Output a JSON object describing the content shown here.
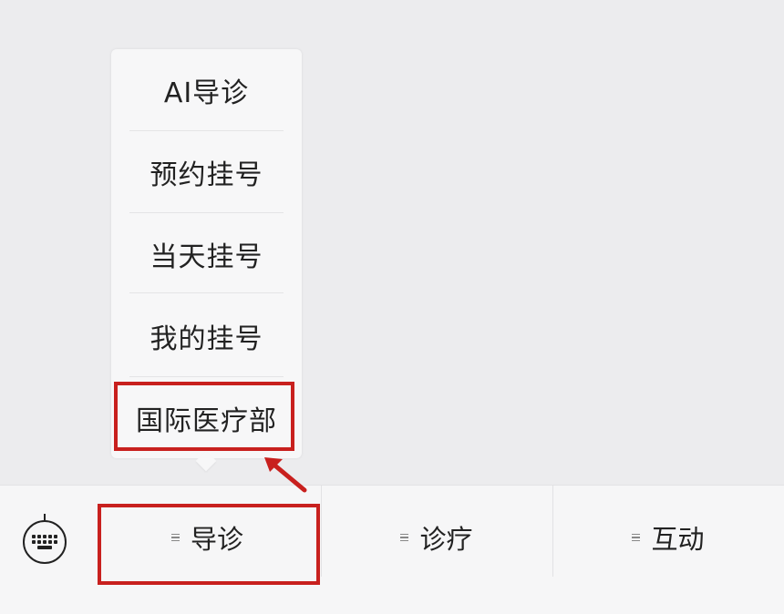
{
  "menu": {
    "items": [
      {
        "label": "AI导诊"
      },
      {
        "label": "预约挂号"
      },
      {
        "label": "当天挂号"
      },
      {
        "label": "我的挂号"
      },
      {
        "label": "国际医疗部"
      }
    ]
  },
  "bottom_bar": {
    "keyboard_icon": "keyboard-icon",
    "tabs": [
      {
        "label": "导诊",
        "icon": "menu-lines-icon"
      },
      {
        "label": "诊疗",
        "icon": "menu-lines-icon"
      },
      {
        "label": "互动",
        "icon": "menu-lines-icon"
      }
    ]
  },
  "annotation": {
    "color": "#c8201e"
  }
}
